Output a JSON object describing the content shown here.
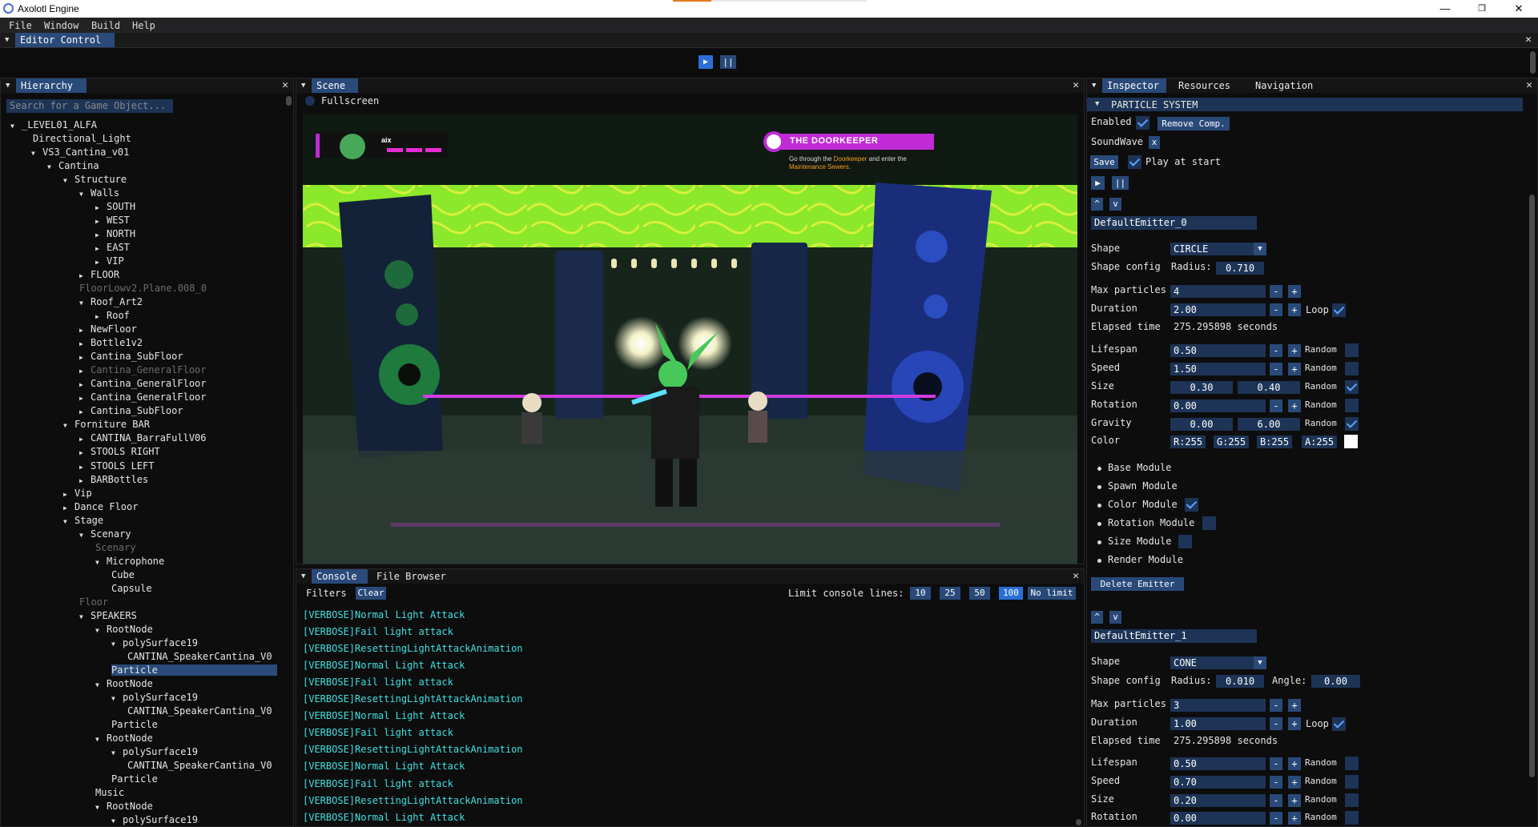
{
  "window": {
    "title": "Axolotl Engine",
    "minimize": "—",
    "maximize": "❐",
    "close": "✕"
  },
  "menu": [
    "File",
    "Window",
    "Build",
    "Help"
  ],
  "editor_control": {
    "tab": "Editor Control",
    "close": "✕",
    "play": "▶",
    "pause": "||"
  },
  "hierarchy": {
    "tab": "Hierarchy",
    "close": "✕",
    "search_placeholder": "Search for a Game Object...",
    "items": [
      {
        "label": "_LEVEL01_ALFA",
        "arrow": "▼",
        "dim": false,
        "sel": false
      },
      {
        "label": "Directional_Light",
        "arrow": "",
        "dim": false,
        "sel": false
      },
      {
        "label": "VS3_Cantina_v01",
        "arrow": "▼",
        "dim": false,
        "sel": false
      },
      {
        "label": "Cantina",
        "arrow": "▼",
        "dim": false,
        "sel": false
      },
      {
        "label": "Structure",
        "arrow": "▼",
        "dim": false,
        "sel": false
      },
      {
        "label": "Walls",
        "arrow": "▼",
        "dim": false,
        "sel": false
      },
      {
        "label": "SOUTH",
        "arrow": "▶",
        "dim": false,
        "sel": false
      },
      {
        "label": "WEST",
        "arrow": "▶",
        "dim": false,
        "sel": false
      },
      {
        "label": "NORTH",
        "arrow": "▶",
        "dim": false,
        "sel": false
      },
      {
        "label": "EAST",
        "arrow": "▶",
        "dim": false,
        "sel": false
      },
      {
        "label": "VIP",
        "arrow": "▶",
        "dim": false,
        "sel": false
      },
      {
        "label": "FLOOR",
        "arrow": "▶",
        "dim": false,
        "sel": false
      },
      {
        "label": "FloorLowv2.Plane.008_0",
        "arrow": "",
        "dim": true,
        "sel": false
      },
      {
        "label": "Roof_Art2",
        "arrow": "▼",
        "dim": false,
        "sel": false
      },
      {
        "label": "Roof",
        "arrow": "▶",
        "dim": false,
        "sel": false
      },
      {
        "label": "NewFloor",
        "arrow": "▶",
        "dim": false,
        "sel": false
      },
      {
        "label": "Bottle1v2",
        "arrow": "▶",
        "dim": false,
        "sel": false
      },
      {
        "label": "Cantina_SubFloor",
        "arrow": "▶",
        "dim": false,
        "sel": false
      },
      {
        "label": "Cantina_GeneralFloor",
        "arrow": "▶",
        "dim": true,
        "sel": false
      },
      {
        "label": "Cantina_GeneralFloor",
        "arrow": "▶",
        "dim": false,
        "sel": false
      },
      {
        "label": "Cantina_GeneralFloor",
        "arrow": "▶",
        "dim": false,
        "sel": false
      },
      {
        "label": "Cantina_SubFloor",
        "arrow": "▶",
        "dim": false,
        "sel": false
      },
      {
        "label": "Forniture BAR",
        "arrow": "▼",
        "dim": false,
        "sel": false
      },
      {
        "label": "CANTINA_BarraFullV06",
        "arrow": "▶",
        "dim": false,
        "sel": false
      },
      {
        "label": "STOOLS RIGHT",
        "arrow": "▶",
        "dim": false,
        "sel": false
      },
      {
        "label": "STOOLS LEFT",
        "arrow": "▶",
        "dim": false,
        "sel": false
      },
      {
        "label": "BARBottles",
        "arrow": "▶",
        "dim": false,
        "sel": false
      },
      {
        "label": "Vip",
        "arrow": "▶",
        "dim": false,
        "sel": false
      },
      {
        "label": "Dance Floor",
        "arrow": "▶",
        "dim": false,
        "sel": false
      },
      {
        "label": "Stage",
        "arrow": "▼",
        "dim": false,
        "sel": false
      },
      {
        "label": "Scenary",
        "arrow": "▼",
        "dim": false,
        "sel": false
      },
      {
        "label": "Scenary",
        "arrow": "",
        "dim": true,
        "sel": false
      },
      {
        "label": "Microphone",
        "arrow": "▼",
        "dim": false,
        "sel": false
      },
      {
        "label": "Cube",
        "arrow": "",
        "dim": false,
        "sel": false
      },
      {
        "label": "Capsule",
        "arrow": "",
        "dim": false,
        "sel": false
      },
      {
        "label": "Floor",
        "arrow": "",
        "dim": true,
        "sel": false
      },
      {
        "label": "SPEAKERS",
        "arrow": "▼",
        "dim": false,
        "sel": false
      },
      {
        "label": "RootNode",
        "arrow": "▼",
        "dim": false,
        "sel": false
      },
      {
        "label": "polySurface19",
        "arrow": "▼",
        "dim": false,
        "sel": false
      },
      {
        "label": "CANTINA_SpeakerCantina_V0",
        "arrow": "",
        "dim": false,
        "sel": false
      },
      {
        "label": "Particle",
        "arrow": "",
        "dim": false,
        "sel": true
      },
      {
        "label": "RootNode",
        "arrow": "▼",
        "dim": false,
        "sel": false
      },
      {
        "label": "polySurface19",
        "arrow": "▼",
        "dim": false,
        "sel": false
      },
      {
        "label": "CANTINA_SpeakerCantina_V0",
        "arrow": "",
        "dim": false,
        "sel": false
      },
      {
        "label": "Particle",
        "arrow": "",
        "dim": false,
        "sel": false
      },
      {
        "label": "RootNode",
        "arrow": "▼",
        "dim": false,
        "sel": false
      },
      {
        "label": "polySurface19",
        "arrow": "▼",
        "dim": false,
        "sel": false
      },
      {
        "label": "CANTINA_SpeakerCantina_V0",
        "arrow": "",
        "dim": false,
        "sel": false
      },
      {
        "label": "Particle",
        "arrow": "",
        "dim": false,
        "sel": false
      },
      {
        "label": "Music",
        "arrow": "",
        "dim": false,
        "sel": false
      },
      {
        "label": "RootNode",
        "arrow": "▼",
        "dim": false,
        "sel": false
      },
      {
        "label": "polySurface19",
        "arrow": "▼",
        "dim": false,
        "sel": false
      }
    ]
  },
  "scene": {
    "tab": "Scene",
    "close": "✕",
    "fullscreen_label": "Fullscreen",
    "hud": {
      "player_name": "aix",
      "quest_title": "THE DOORKEEPER",
      "quest_text_a": "Go through the ",
      "quest_highlight_a": "Doorkeeper",
      "quest_text_b": " and enter the",
      "quest_highlight_b": "Maintenance Sewers",
      "quest_text_c": "."
    }
  },
  "console": {
    "tab": "Console",
    "tab2": "File Browser",
    "close": "✕",
    "filters": "Filters",
    "clear": "Clear",
    "limit_label": "Limit console lines:",
    "limits": [
      "10",
      "25",
      "50",
      "100",
      "No limit"
    ],
    "active_limit": "100",
    "lines": [
      "[VERBOSE]Normal Light Attack",
      "[VERBOSE]Fail light attack",
      "[VERBOSE]ResettingLightAttackAnimation",
      "[VERBOSE]Normal Light Attack",
      "[VERBOSE]Fail light attack",
      "[VERBOSE]ResettingLightAttackAnimation",
      "[VERBOSE]Normal Light Attack",
      "[VERBOSE]Fail light attack",
      "[VERBOSE]ResettingLightAttackAnimation",
      "[VERBOSE]Normal Light Attack",
      "[VERBOSE]Fail light attack",
      "[VERBOSE]ResettingLightAttackAnimation",
      "[VERBOSE]Normal Light Attack"
    ]
  },
  "inspector": {
    "tabs": [
      "Inspector",
      "Resources",
      "Navigation"
    ],
    "close": "✕",
    "component_title": "PARTICLE SYSTEM",
    "enabled_label": "Enabled",
    "remove_label": "Remove Comp.",
    "soundwave_label": "SoundWave",
    "soundwave_x": "x",
    "save_label": "Save",
    "play_at_start_label": "Play at start",
    "play": "▶",
    "pause": "||",
    "up": "^",
    "down": "v",
    "shape_label": "Shape",
    "shape_config_label": "Shape config",
    "radius_label": "Radius:",
    "angle_label": "Angle:",
    "max_particles_label": "Max particles",
    "duration_label": "Duration",
    "loop_label": "Loop",
    "elapsed_label": "Elapsed time",
    "lifespan_label": "Lifespan",
    "speed_label": "Speed",
    "size_label": "Size",
    "rotation_label": "Rotation",
    "gravity_label": "Gravity",
    "color_label": "Color",
    "random_label": "Random",
    "minus": "-",
    "plus": "+",
    "modules": [
      "Base Module",
      "Spawn Module",
      "Color Module",
      "Rotation Module",
      "Size Module",
      "Render Module"
    ],
    "delete_emitter": "Delete Emitter",
    "emitter0": {
      "name": "DefaultEmitter_0",
      "shape": "CIRCLE",
      "radius": "0.710",
      "max_particles": "4",
      "duration": "2.00",
      "elapsed": "275.295898 seconds",
      "lifespan": "0.50",
      "speed": "1.50",
      "size_a": "0.30",
      "size_b": "0.40",
      "rotation": "0.00",
      "gravity_a": "0.00",
      "gravity_b": "6.00",
      "color_r": "R:255",
      "color_g": "G:255",
      "color_b": "B:255",
      "color_a": "A:255"
    },
    "emitter1": {
      "name": "DefaultEmitter_1",
      "shape": "CONE",
      "radius": "0.010",
      "angle": "0.00",
      "max_particles": "3",
      "duration": "1.00",
      "elapsed": "275.295898 seconds",
      "lifespan": "0.50",
      "speed": "0.70",
      "size": "0.20",
      "rotation": "0.00"
    }
  },
  "colors": {
    "accent": "#2a4a79",
    "accent_bright": "#2a6fd6",
    "console_text": "#3fe0e0",
    "quest_purple": "#c02bd6"
  }
}
